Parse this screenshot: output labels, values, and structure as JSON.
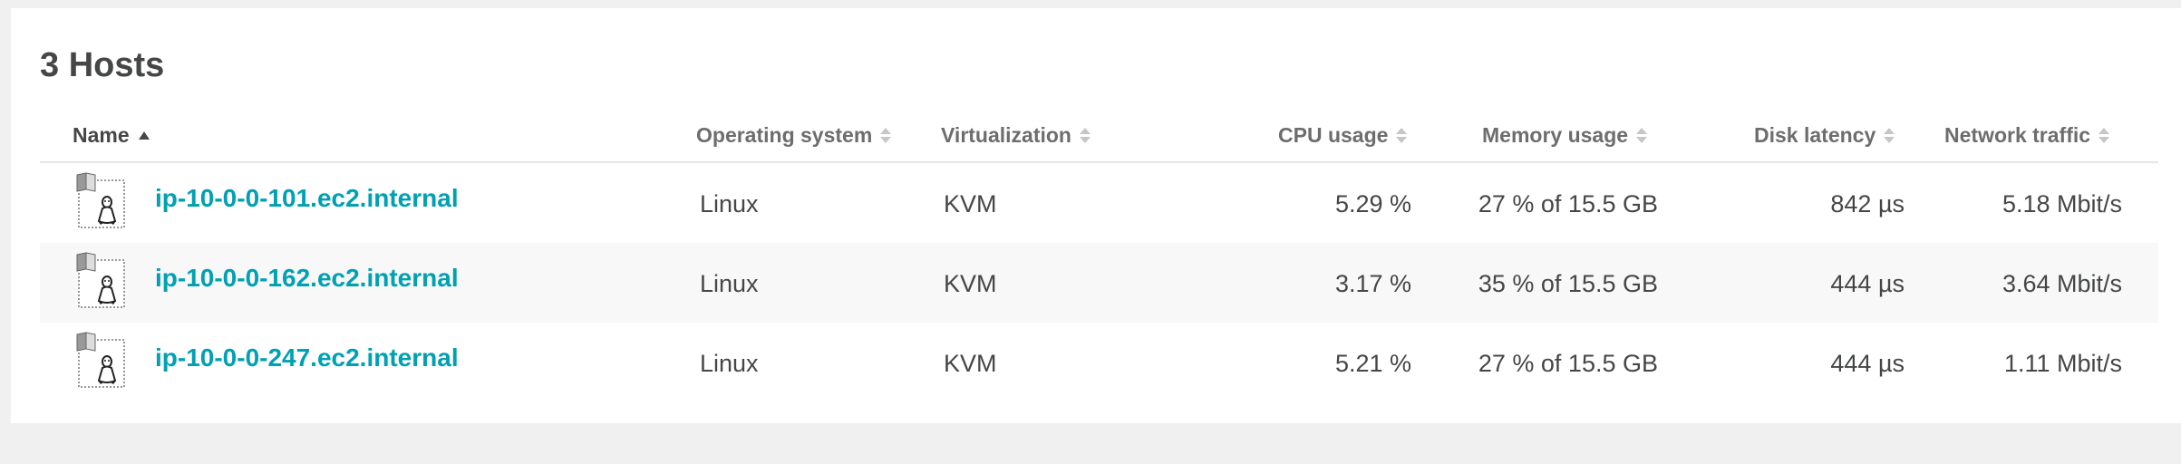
{
  "title": "3 Hosts",
  "columns": {
    "name": "Name",
    "os": "Operating system",
    "virtualization": "Virtualization",
    "cpu": "CPU usage",
    "memory": "Memory usage",
    "disk": "Disk latency",
    "network": "Network traffic"
  },
  "rows": [
    {
      "icon": "linux-host-icon",
      "name": "ip-10-0-0-101.ec2.internal",
      "os": "Linux",
      "virtualization": "KVM",
      "cpu": "5.29 %",
      "memory": "27 % of 15.5 GB",
      "disk": "842 µs",
      "network": "5.18 Mbit/s"
    },
    {
      "icon": "linux-host-icon",
      "name": "ip-10-0-0-162.ec2.internal",
      "os": "Linux",
      "virtualization": "KVM",
      "cpu": "3.17 %",
      "memory": "35 % of 15.5 GB",
      "disk": "444 µs",
      "network": "3.64 Mbit/s"
    },
    {
      "icon": "linux-host-icon",
      "name": "ip-10-0-0-247.ec2.internal",
      "os": "Linux",
      "virtualization": "KVM",
      "cpu": "5.21 %",
      "memory": "27 % of 15.5 GB",
      "disk": "444 µs",
      "network": "1.11 Mbit/s"
    }
  ],
  "colors": {
    "link": "#00a1b2",
    "text": "#454646",
    "header_text": "#6d6d6d",
    "background": "#f0f0f0",
    "panel": "#ffffff",
    "row_alt": "#f8f8f8"
  }
}
